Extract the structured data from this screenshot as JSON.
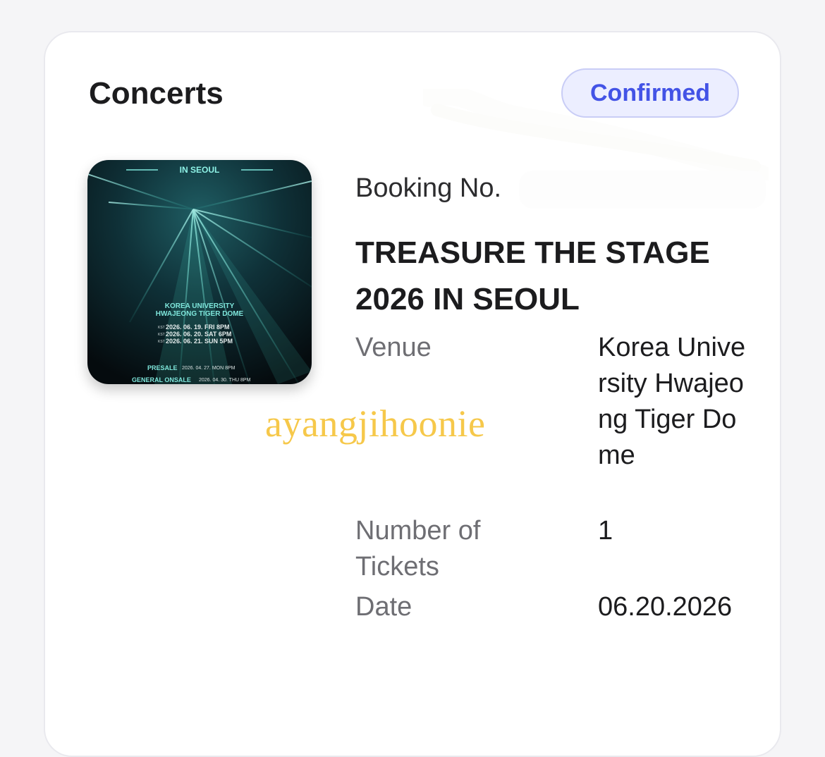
{
  "section": {
    "title": "Concerts"
  },
  "status": {
    "label": "Confirmed",
    "color": "#4353e6",
    "bg": "#eceeff"
  },
  "poster": {
    "header": "IN SEOUL",
    "venue_line1": "KOREA UNIVERSITY",
    "venue_line2": "HWAJEONG TIGER DOME",
    "kst": "KST",
    "dates": [
      "2026. 06. 19. FRI 8PM",
      "2026. 06. 20. SAT 6PM",
      "2026. 06. 21. SUN 5PM"
    ],
    "presale_label": "PRESALE",
    "presale_date": "2026. 04. 27. MON 8PM",
    "onsale_label": "GENERAL ONSALE",
    "onsale_date": "2026. 04. 30. THU 8PM"
  },
  "booking": {
    "label": "Booking No."
  },
  "event": {
    "title": "TREASURE THE STAGE 2026 IN SEOUL"
  },
  "details": {
    "venue_label": "Venue",
    "venue_value": "Korea University Hwajeong Tiger Dome",
    "tickets_label": "Number of Tickets",
    "tickets_value": "1",
    "date_label": "Date",
    "date_value": "06.20.2026"
  },
  "watermark": {
    "text": "ayangjihoonie"
  }
}
